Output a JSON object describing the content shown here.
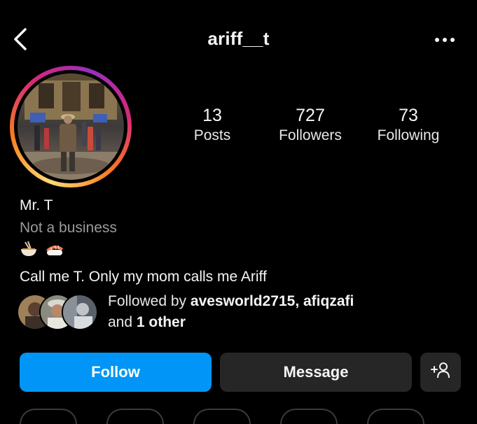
{
  "header": {
    "username": "ariff__t",
    "back_icon": "chevron-left-icon",
    "more_icon": "more-horizontal-icon"
  },
  "profile": {
    "avatar": "profile-photo",
    "story_ring_colors": [
      "#feda75",
      "#fa7e1e",
      "#d62976",
      "#962fbf"
    ]
  },
  "stats": {
    "posts": {
      "count": "13",
      "label": "Posts"
    },
    "followers": {
      "count": "727",
      "label": "Followers"
    },
    "following": {
      "count": "73",
      "label": "Following"
    }
  },
  "bio": {
    "name": "Mr. T",
    "category": "Not a business",
    "emojis": [
      "noodle-bowl-icon",
      "sushi-icon"
    ],
    "text": "Call me T. Only my mom calls me Ariff"
  },
  "followed_by": {
    "prefix": "Followed by ",
    "users": "avesworld2715, afiqzafi",
    "line2_prefix": "and ",
    "others": "1 other"
  },
  "actions": {
    "follow_label": "Follow",
    "message_label": "Message",
    "suggest_icon": "add-person-icon"
  },
  "colors": {
    "background": "#000000",
    "follow_button": "#0095f6",
    "secondary_button": "#262626",
    "muted_text": "#9a9a9a"
  }
}
